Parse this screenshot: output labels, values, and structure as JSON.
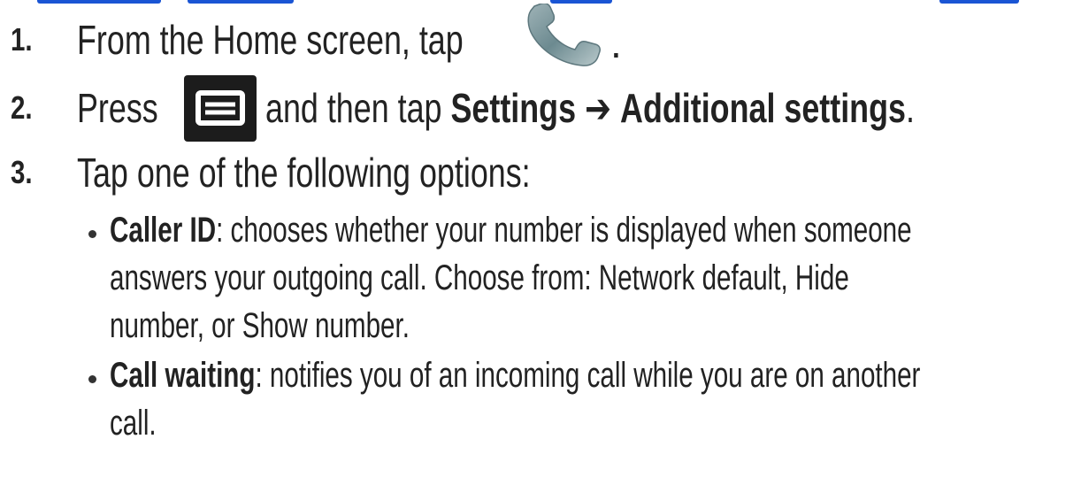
{
  "steps": [
    {
      "number": "1.",
      "text": "From the Home screen, tap",
      "suffix": "."
    },
    {
      "number": "2.",
      "pre": "Press",
      "mid": "and then tap",
      "bold1": "Settings",
      "arrow": "➔",
      "bold2": "Additional settings",
      "end": "."
    },
    {
      "number": "3.",
      "text": "Tap one of the following options:"
    }
  ],
  "bullets": [
    {
      "term": "Caller ID",
      "lines": [
        ": chooses whether your number is displayed when someone",
        "answers your outgoing call. Choose from: Network default, Hide",
        "number, or Show number."
      ]
    },
    {
      "term": "Call waiting",
      "lines": [
        ": notifies you of an incoming call while you are on another",
        "call."
      ]
    }
  ],
  "icons": {
    "phone": "phone-icon",
    "menu": "menu-icon"
  },
  "colors": {
    "heading": "#1a55d4",
    "text": "#222222",
    "menu_bg": "#1c1c1c",
    "phone": "#6f8c92"
  }
}
